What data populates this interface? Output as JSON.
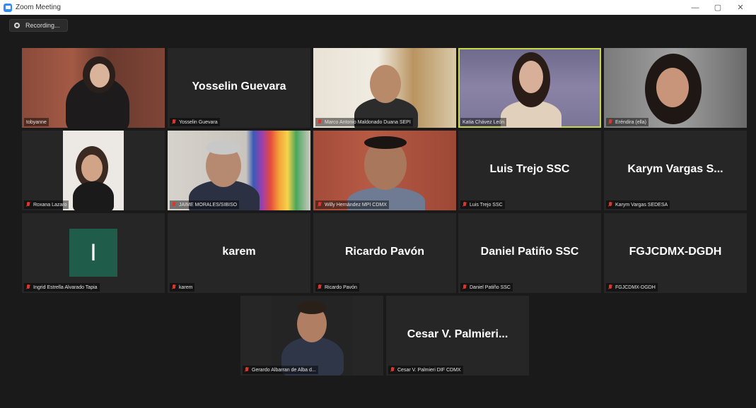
{
  "window": {
    "title": "Zoom Meeting",
    "minimize": "—",
    "maximize": "▢",
    "close": "✕"
  },
  "recording": {
    "label": "Recording..."
  },
  "participants": [
    {
      "label": "tobyanne",
      "display_name": "",
      "video": true
    },
    {
      "label": "Yosselin Guevara",
      "display_name": "Yosselin Guevara",
      "video": false
    },
    {
      "label": "Marco Antonio Maldonado Duana SEPI",
      "display_name": "",
      "video": true
    },
    {
      "label": "Katia Chávez León",
      "display_name": "",
      "video": true,
      "active_speaker": true
    },
    {
      "label": "Eréndira (ella)",
      "display_name": "",
      "video": true
    },
    {
      "label": "Roxana Lazaro",
      "display_name": "",
      "video": true
    },
    {
      "label": "JAIME MORALES/SIBISO",
      "display_name": "",
      "video": true
    },
    {
      "label": "Willy Hernández MPI CDMX",
      "display_name": "",
      "video": true
    },
    {
      "label": "Luis Trejo SSC",
      "display_name": "Luis Trejo SSC",
      "video": false
    },
    {
      "label": "Karym Vargas SEDESA",
      "display_name": "Karym Vargas S...",
      "video": false
    },
    {
      "label": "Ingrid Estrella Alvarado Tapia",
      "display_name": "",
      "avatar_letter": "I",
      "video": false
    },
    {
      "label": "karem",
      "display_name": "karem",
      "video": false
    },
    {
      "label": "Ricardo Pavón",
      "display_name": "Ricardo Pavón",
      "video": false
    },
    {
      "label": "Daniel Patiño SSC",
      "display_name": "Daniel Patiño SSC",
      "video": false
    },
    {
      "label": "FGJCDMX-DGDH",
      "display_name": "FGJCDMX-DGDH",
      "video": false
    },
    {
      "label": "Gerardo Albarran de Alba d...",
      "display_name": "",
      "video": true
    },
    {
      "label": "Cesar V. Palmieri DIF CDMX",
      "display_name": "Cesar V. Palmieri...",
      "video": false
    }
  ],
  "colors": {
    "active_speaker_border": "#c8d64a",
    "muted_mic": "#e0352b",
    "tile_bg": "#262626",
    "avatar_bg": "#1f5d4a"
  }
}
